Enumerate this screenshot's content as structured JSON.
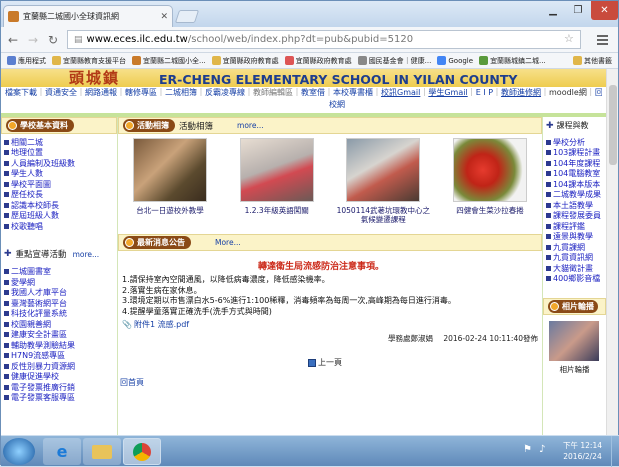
{
  "browser": {
    "tab_title": "宜蘭縣二城國小全球資訊網",
    "url_host": "www.eces.ilc.edu.tw",
    "url_path": "/school/web/index.php?dt=pub&pubid=5120",
    "bookmarks": [
      "應用程式",
      "宜蘭縣教育支援平台",
      "宜蘭縣二城國小全...",
      "宜蘭縣政府教育處",
      "宜蘭縣政府教育處",
      "國民基金會｜健康...",
      "Google",
      "宜蘭縣城鎮二城...",
      "其他書籤"
    ]
  },
  "banner": {
    "logo_text": "頭城鎮",
    "english_name": "ER-CHENG ELEMENTARY SCHOOL IN YILAN COUNTY"
  },
  "topnav": {
    "line1": [
      "檔案下載",
      "資通安全",
      "網路通報",
      "轄修專區",
      "二城相簿",
      "反霸凌專線",
      "教師編輯區",
      "教室借",
      "本校專書櫃",
      "校訊Gmail",
      "學生Gmail",
      "E I P",
      "教師進修網",
      "moodle網",
      "回首"
    ],
    "line2": "校網"
  },
  "left": {
    "box1_title": "學校基本資料",
    "box1_items": [
      "相關二城",
      "地理位置",
      "人員編制及班級數",
      "學生人數",
      "學校平面圖",
      "歷任校長",
      "認識本校師長",
      "歷屆班級人數",
      "校歌聽唱"
    ],
    "box2_title": "重點宣導活動",
    "box2_more": "more...",
    "box2_items": [
      "二城圖書室",
      "愛學網",
      "我國人才庫平台",
      "臺灣藝術網平台",
      "科技化評量系統",
      "校園親善網",
      "建康安全計畫區",
      "輔助教學測驗結果",
      "H7N9流感專區",
      "反性別暴力資源網",
      "健康促進學校",
      "電子發票推廣行銷",
      "電子發票客服專區"
    ]
  },
  "mid": {
    "album_title": "活動相簿",
    "album_label": "活動相簿",
    "album_more": "more...",
    "photos": [
      {
        "caption": "台北一日遊校外教學"
      },
      {
        "caption": "1.2.3年級英語闖關"
      },
      {
        "caption": "1050114武荖坑環教中心之氣候變遷課程"
      },
      {
        "caption": "四健會生菜沙拉春捲"
      }
    ],
    "news_title": "最新消息公告",
    "news_more": "More...",
    "news_headline": "轉達衛生局流感防治注意事項。",
    "news_lines": [
      "1.請保持室內空間通風，以降低病毒濃度，降低感染機率。",
      "2.落實生病在家休息。",
      "3.環境定期以市售漂白水5-6%進行1:100稀釋，消毒頻率為每周一次,高峰期為每日進行消毒。",
      "4.提醒學童落實正確洗手(洗手方式與時間)"
    ],
    "attachment": "附件1 流感.pdf",
    "poster": "學務處鄭淑娟",
    "posted_at": "2016-02-24 10:11:40發佈",
    "prev_page": "上一頁",
    "back_home": "回首頁"
  },
  "right": {
    "box1_title": "課程與教",
    "box1_items": [
      "學校分析",
      "103課程計畫",
      "104年度課程",
      "104電腦教室",
      "104課本版本",
      "二城教學成果",
      "本土語教學",
      "課程發展委員",
      "課程評鑑",
      "遠景與教學",
      "九貫課網",
      "九貫資訊網",
      "大貓徵計畫",
      "400鄉影音檔"
    ],
    "box2_title": "相片輪播",
    "box2_caption": "相片輪播"
  },
  "taskbar": {
    "time": "下午 12:14",
    "date": "2016/2/24"
  },
  "colors": {
    "link_blue": "#1740a6",
    "headline_red": "#cc2b1b",
    "pill_brown": "#8a4a16",
    "banner_gold": "#eecc4f"
  }
}
